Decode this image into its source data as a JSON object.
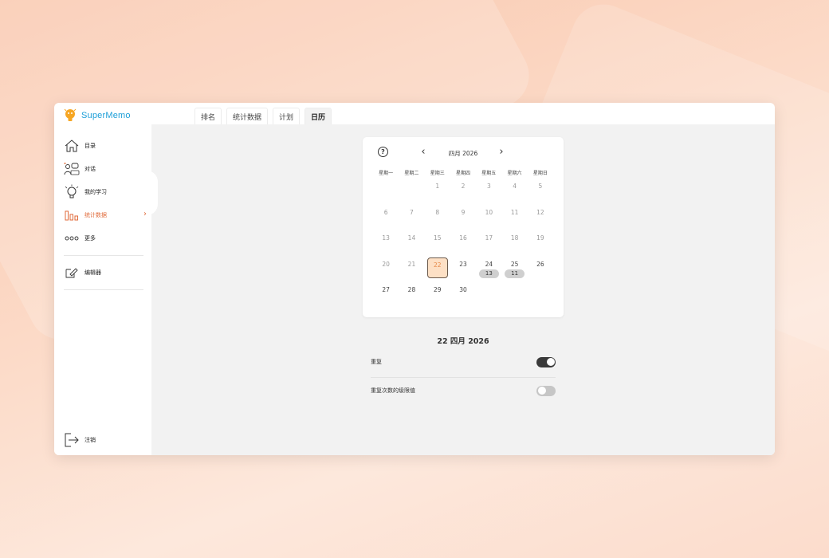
{
  "app": {
    "logo_text": "SuperMemo"
  },
  "tabs": [
    {
      "label": "排名",
      "active": false
    },
    {
      "label": "统计数据",
      "active": false
    },
    {
      "label": "计划",
      "active": false
    },
    {
      "label": "日历",
      "active": true
    }
  ],
  "sidebar": {
    "items": [
      {
        "label": "目录",
        "icon": "home-icon",
        "active": false
      },
      {
        "label": "对话",
        "icon": "chat-robot-icon",
        "active": false
      },
      {
        "label": "我的学习",
        "icon": "lightbulb-icon",
        "active": false
      },
      {
        "label": "统计数据",
        "icon": "bar-chart-icon",
        "active": true
      },
      {
        "label": "更多",
        "icon": "more-dots-icon",
        "active": false
      },
      {
        "label": "编辑器",
        "icon": "edit-icon",
        "active": false
      }
    ],
    "logout_label": "注销"
  },
  "calendar": {
    "month_label": "四月 2026",
    "prev_glyph": "‹",
    "next_glyph": "›",
    "help_glyph": "?",
    "weekdays": [
      "星期一",
      "星期二",
      "星期三",
      "星期四",
      "星期五",
      "星期六",
      "星期日"
    ],
    "leading_blank_days": 2,
    "days": [
      {
        "day": "1",
        "state": "past"
      },
      {
        "day": "2",
        "state": "past"
      },
      {
        "day": "3",
        "state": "past"
      },
      {
        "day": "4",
        "state": "past"
      },
      {
        "day": "5",
        "state": "past"
      },
      {
        "day": "6",
        "state": "past"
      },
      {
        "day": "7",
        "state": "past"
      },
      {
        "day": "8",
        "state": "past"
      },
      {
        "day": "9",
        "state": "past"
      },
      {
        "day": "10",
        "state": "past"
      },
      {
        "day": "11",
        "state": "past"
      },
      {
        "day": "12",
        "state": "past"
      },
      {
        "day": "13",
        "state": "past"
      },
      {
        "day": "14",
        "state": "past"
      },
      {
        "day": "15",
        "state": "past"
      },
      {
        "day": "16",
        "state": "past"
      },
      {
        "day": "17",
        "state": "past"
      },
      {
        "day": "18",
        "state": "past"
      },
      {
        "day": "19",
        "state": "past"
      },
      {
        "day": "20",
        "state": "past"
      },
      {
        "day": "21",
        "state": "past"
      },
      {
        "day": "22",
        "state": "today"
      },
      {
        "day": "23",
        "state": "future"
      },
      {
        "day": "24",
        "state": "future",
        "badge": "13"
      },
      {
        "day": "25",
        "state": "future",
        "badge": "11"
      },
      {
        "day": "26",
        "state": "future"
      },
      {
        "day": "27",
        "state": "future"
      },
      {
        "day": "28",
        "state": "future"
      },
      {
        "day": "29",
        "state": "future"
      },
      {
        "day": "30",
        "state": "future"
      }
    ]
  },
  "detail": {
    "date_label": "22 四月 2026",
    "toggles": [
      {
        "label": "重复",
        "on": true
      },
      {
        "label": "重复次数的级限值",
        "on": false
      }
    ]
  }
}
